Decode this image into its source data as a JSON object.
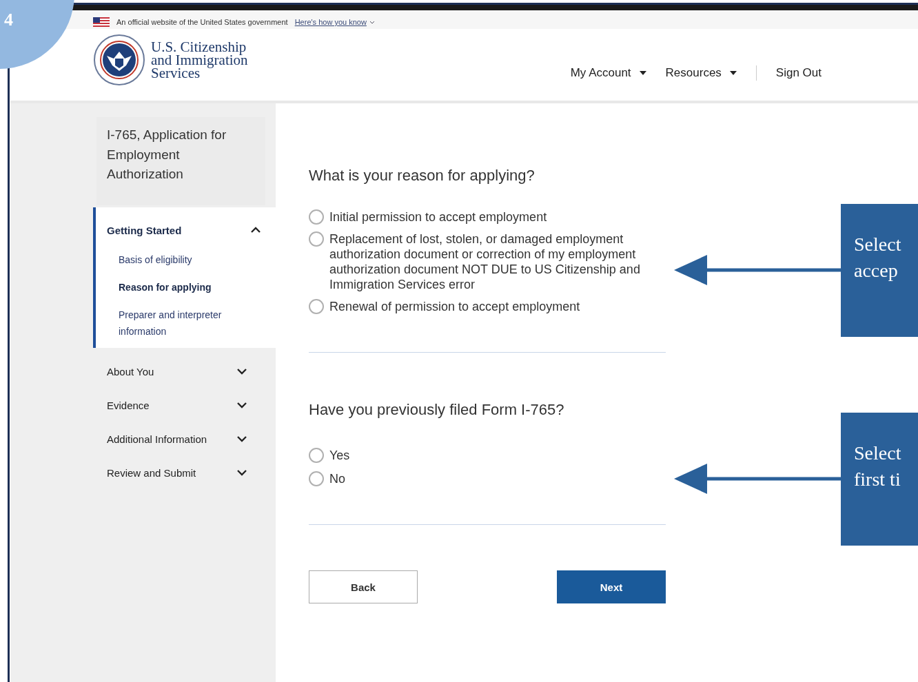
{
  "slide": {
    "badge": "4"
  },
  "banner": {
    "text": "An official website of the United States government",
    "link": "Here's how you know"
  },
  "header": {
    "logo_lines": [
      "U.S. Citizenship",
      "and Immigration",
      "Services"
    ],
    "nav": [
      {
        "label": "My Account",
        "dropdown": true
      },
      {
        "label": "Resources",
        "dropdown": true
      },
      {
        "label": "Sign Out",
        "dropdown": false
      }
    ]
  },
  "sidebar": {
    "title": "I-765, Application for Employment Authorization",
    "sections": [
      {
        "label": "Getting Started",
        "expanded": true,
        "children": [
          {
            "label": "Basis of eligibility",
            "selected": false
          },
          {
            "label": "Reason for applying",
            "selected": true
          },
          {
            "label": "Preparer and interpreter information",
            "selected": false
          }
        ]
      },
      {
        "label": "About You",
        "expanded": false
      },
      {
        "label": "Evidence",
        "expanded": false
      },
      {
        "label": "Additional Information",
        "expanded": false
      },
      {
        "label": "Review and Submit",
        "expanded": false
      }
    ]
  },
  "questions": [
    {
      "question": "What is your reason for applying?",
      "options": [
        {
          "label": "Initial permission to accept employment",
          "selected": false
        },
        {
          "label": "Replacement of lost, stolen, or damaged employment authorization document or correction of my employment authorization document NOT DUE to US Citizenship and Immigration Services error",
          "selected": false
        },
        {
          "label": "Renewal of permission to accept employment",
          "selected": false
        }
      ]
    },
    {
      "question": "Have you previously filed Form I-765?",
      "options": [
        {
          "label": "Yes",
          "selected": false
        },
        {
          "label": "No",
          "selected": false
        }
      ]
    }
  ],
  "buttons": [
    {
      "label": "Back",
      "kind": "secondary"
    },
    {
      "label": "Next",
      "kind": "primary"
    }
  ],
  "callouts": [
    {
      "text": "Select\naccep"
    },
    {
      "text": "Select\nfirst ti"
    }
  ]
}
